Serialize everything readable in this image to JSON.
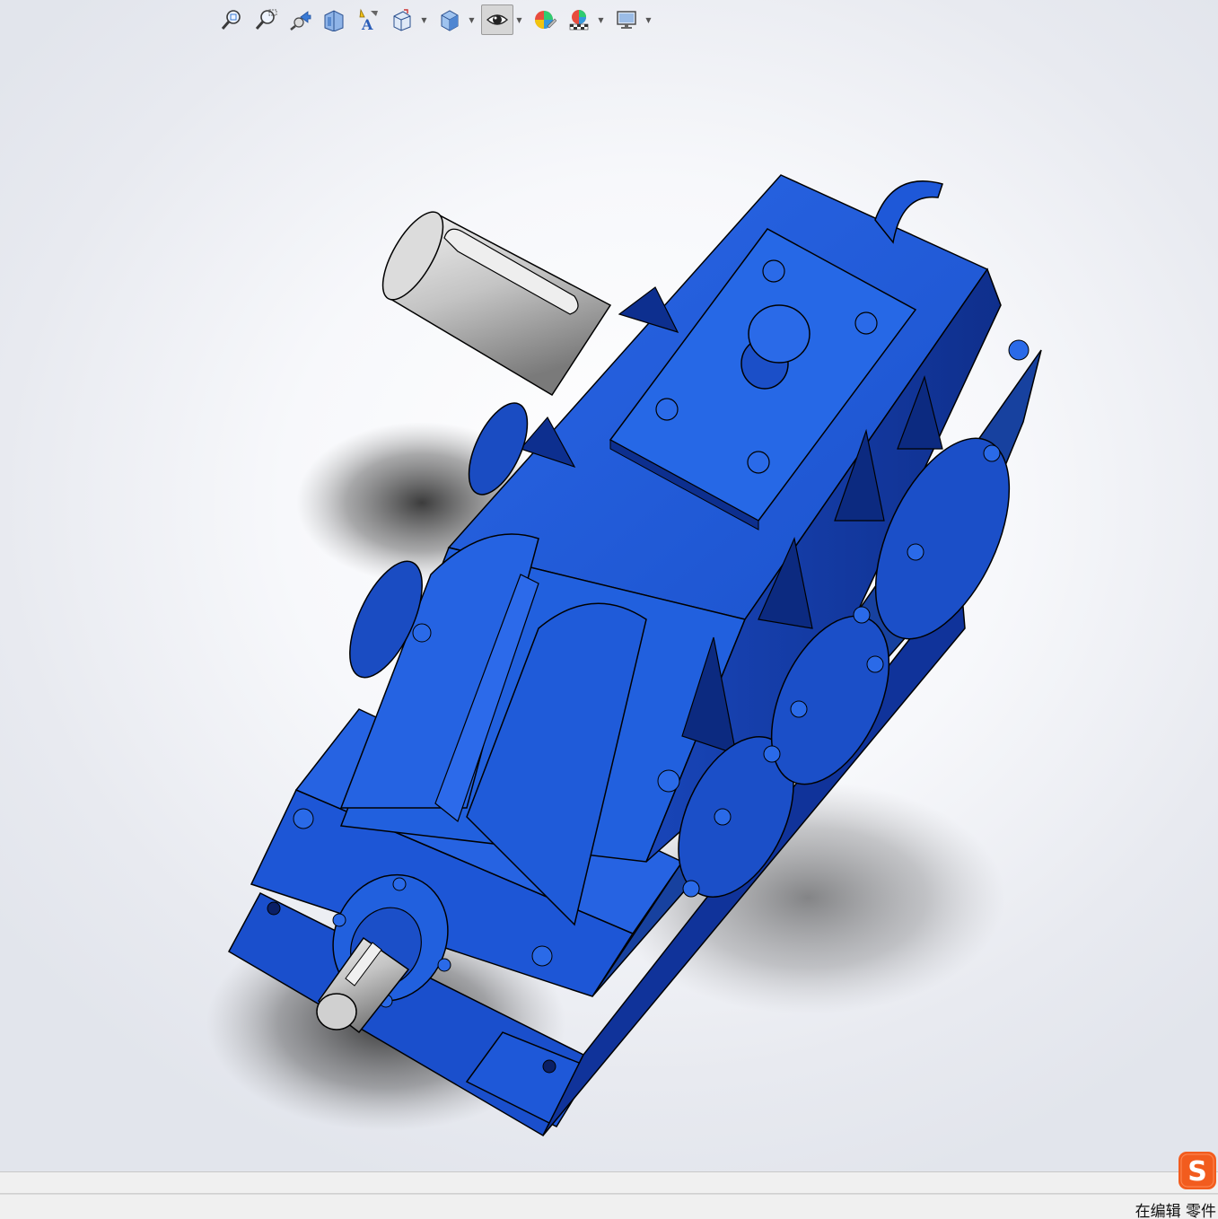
{
  "toolbar": {
    "items": [
      {
        "icon": "zoom-to-fit-icon"
      },
      {
        "icon": "zoom-to-area-icon"
      },
      {
        "icon": "previous-view-icon"
      },
      {
        "icon": "section-view-icon"
      },
      {
        "icon": "dynamic-annotation-view-icon"
      },
      {
        "icon": "view-orientation-icon"
      },
      {
        "icon": "display-style-icon"
      },
      {
        "icon": "hide-show-items-icon"
      },
      {
        "icon": "edit-appearance-icon"
      },
      {
        "icon": "apply-scene-icon"
      },
      {
        "icon": "view-settings-icon"
      }
    ],
    "active_item": "hide-show-items-icon"
  },
  "colors": {
    "housing": "#1f5ad6",
    "housing_dark": "#0d2f8f",
    "shaft": "#c9c9c9",
    "background": "#eef0f5"
  },
  "status_bar": {
    "text": "在编辑 零件"
  },
  "ime": {
    "glyph": "S"
  }
}
